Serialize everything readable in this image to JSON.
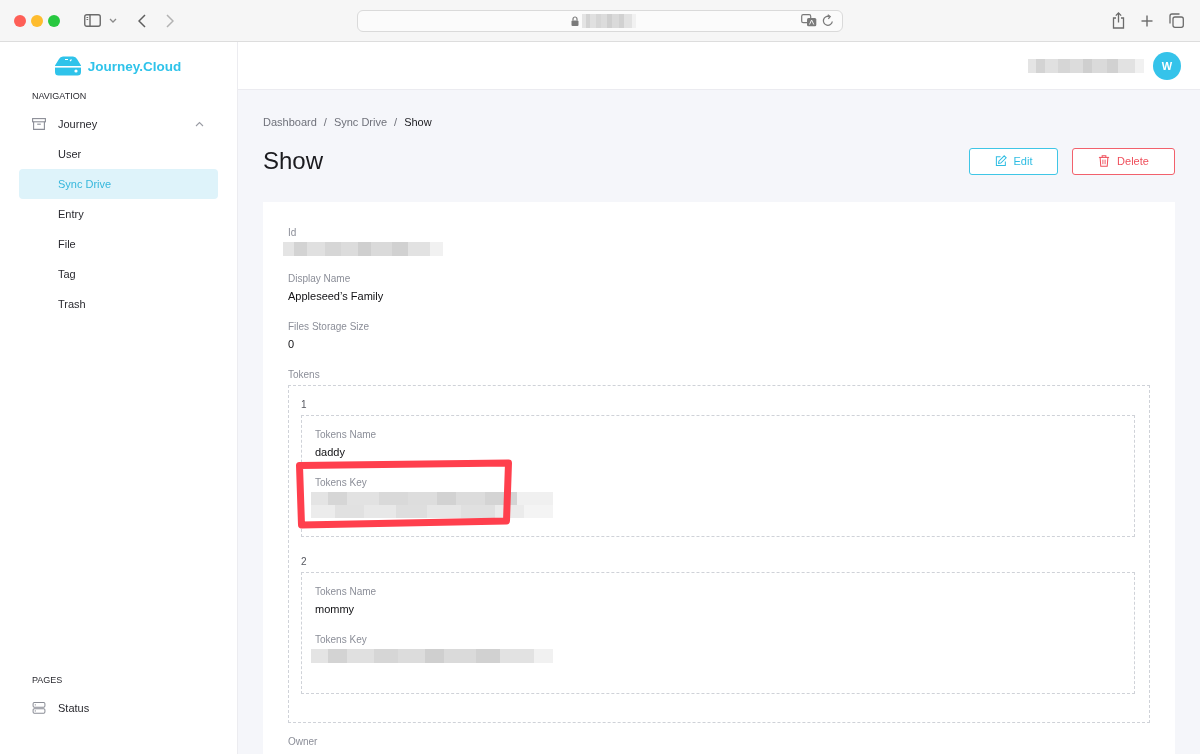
{
  "browser": {
    "address": {
      "kind": "redacted"
    }
  },
  "sidebar": {
    "logo": "Journey.Cloud",
    "sections": [
      {
        "title": "NAVIGATION",
        "items": [
          {
            "label": "Journey",
            "kind": "module",
            "selected": false,
            "expanded": true,
            "children": [
              {
                "label": "User",
                "selected": false
              },
              {
                "label": "Sync Drive",
                "selected": true
              },
              {
                "label": "Entry",
                "selected": false
              },
              {
                "label": "File",
                "selected": false
              },
              {
                "label": "Tag",
                "selected": false
              },
              {
                "label": "Trash",
                "selected": false
              }
            ]
          }
        ]
      },
      {
        "title": "PAGES",
        "items": [
          {
            "label": "Status",
            "kind": "page",
            "selected": false
          }
        ]
      }
    ]
  },
  "header": {
    "user": {
      "name": {
        "kind": "redacted"
      },
      "avatar": "W"
    }
  },
  "breadcrumb": [
    {
      "label": "Dashboard",
      "current": false,
      "separator": "/"
    },
    {
      "label": "Sync Drive",
      "current": false,
      "separator": "/"
    },
    {
      "label": "Show",
      "current": true
    }
  ],
  "page": {
    "title": "Show",
    "actions": [
      {
        "label": "Edit",
        "kind": "edit"
      },
      {
        "label": "Delete",
        "kind": "delete"
      }
    ]
  },
  "record": {
    "fields": [
      {
        "label": "Id",
        "kind": "redacted",
        "wrap": false
      },
      {
        "label": "Display Name",
        "kind": "text",
        "value": "Appleseed’s Family"
      },
      {
        "label": "Files Storage Size",
        "kind": "text",
        "value": "0"
      },
      {
        "label": "Tokens",
        "kind": "list",
        "items": [
          {
            "index": "1",
            "fields": [
              {
                "label": "Tokens Name",
                "kind": "text",
                "value": "daddy",
                "highlighted": false
              },
              {
                "label": "Tokens Key",
                "kind": "redacted",
                "wrap": true,
                "highlighted": true
              }
            ]
          },
          {
            "index": "2",
            "fields": [
              {
                "label": "Tokens Name",
                "kind": "text",
                "value": "mommy",
                "highlighted": false
              },
              {
                "label": "Tokens Key",
                "kind": "redacted",
                "wrap": false,
                "highlighted": false
              }
            ]
          }
        ]
      },
      {
        "label": "Owner",
        "kind": "text"
      }
    ]
  }
}
